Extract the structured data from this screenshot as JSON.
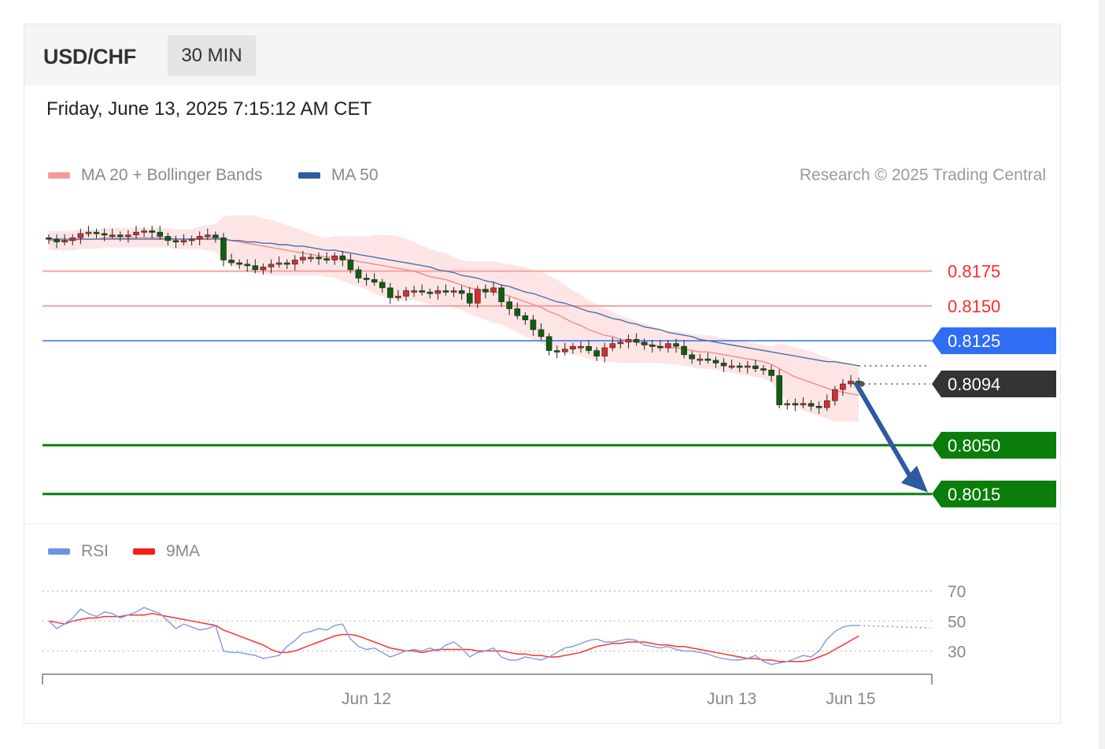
{
  "header": {
    "symbol": "USD/CHF",
    "timeframe": "30 MIN"
  },
  "timestamp": "Friday, June 13, 2025 7:15:12 AM CET",
  "legend": {
    "main": [
      {
        "label": "MA 20 + Bollinger Bands",
        "color": "#f59a9a"
      },
      {
        "label": "MA 50",
        "color": "#2f5d9e"
      }
    ],
    "rsi": [
      {
        "label": "RSI",
        "color": "#6f93e0"
      },
      {
        "label": "9MA",
        "color": "#ff1a1a"
      }
    ]
  },
  "credit": "Research © 2025 Trading Central",
  "colors": {
    "resistance": "#ff2b2b",
    "pivot": "#2f6df5",
    "support": "#0a7d0a",
    "current": "#333333",
    "arrow": "#2d5aa0",
    "bull": "#d43030",
    "bear": "#0f5f0f"
  },
  "chart_data": {
    "type": "candlestick",
    "instrument": "USD/CHF",
    "interval": "30 MIN",
    "levels": [
      {
        "value": 0.8175,
        "label": "0.8175",
        "role": "resistance"
      },
      {
        "value": 0.815,
        "label": "0.8150",
        "role": "resistance"
      },
      {
        "value": 0.8125,
        "label": "0.8125",
        "role": "pivot"
      },
      {
        "value": 0.8094,
        "label": "0.8094",
        "role": "current"
      },
      {
        "value": 0.805,
        "label": "0.8050",
        "role": "support"
      },
      {
        "value": 0.8015,
        "label": "0.8015",
        "role": "support"
      }
    ],
    "price_range": [
      0.8007,
      0.822
    ],
    "forecast_arrow": {
      "from": 0.8094,
      "to": 0.8015
    },
    "close": [
      0.8198,
      0.8196,
      0.8197,
      0.8199,
      0.8202,
      0.8203,
      0.8202,
      0.8201,
      0.8201,
      0.82,
      0.8201,
      0.8203,
      0.8204,
      0.8203,
      0.82,
      0.8197,
      0.8196,
      0.8197,
      0.8198,
      0.82,
      0.8201,
      0.8199,
      0.8183,
      0.8181,
      0.818,
      0.8179,
      0.8176,
      0.8178,
      0.818,
      0.8181,
      0.818,
      0.8183,
      0.8185,
      0.8185,
      0.8184,
      0.8183,
      0.8186,
      0.8183,
      0.8176,
      0.817,
      0.8169,
      0.8167,
      0.8163,
      0.8156,
      0.8157,
      0.8161,
      0.8161,
      0.816,
      0.8159,
      0.8161,
      0.816,
      0.8161,
      0.8159,
      0.8152,
      0.8162,
      0.816,
      0.8163,
      0.8153,
      0.8148,
      0.8143,
      0.814,
      0.8133,
      0.8128,
      0.8118,
      0.8117,
      0.8119,
      0.8121,
      0.8121,
      0.8118,
      0.8114,
      0.812,
      0.8123,
      0.8124,
      0.8126,
      0.8124,
      0.8122,
      0.8121,
      0.812,
      0.8123,
      0.8121,
      0.8115,
      0.8112,
      0.8112,
      0.8111,
      0.8109,
      0.8107,
      0.8107,
      0.8106,
      0.8107,
      0.8105,
      0.8104,
      0.81,
      0.8079,
      0.808,
      0.8079,
      0.808,
      0.8078,
      0.8077,
      0.8082,
      0.809,
      0.8094,
      0.8096,
      0.8094
    ],
    "ma20": [
      0.8197,
      0.8197,
      0.8197,
      0.8197,
      0.8198,
      0.8198,
      0.8198,
      0.8199,
      0.8199,
      0.8199,
      0.8199,
      0.8199,
      0.8199,
      0.8199,
      0.8199,
      0.8199,
      0.8198,
      0.8198,
      0.8198,
      0.8199,
      0.8199,
      0.8199,
      0.8198,
      0.8197,
      0.8196,
      0.8195,
      0.8194,
      0.8193,
      0.8192,
      0.8191,
      0.819,
      0.8189,
      0.8188,
      0.8187,
      0.8186,
      0.8185,
      0.8185,
      0.8184,
      0.8183,
      0.8182,
      0.8181,
      0.818,
      0.8179,
      0.8178,
      0.8177,
      0.8176,
      0.8175,
      0.8173,
      0.8171,
      0.817,
      0.8169,
      0.8167,
      0.8165,
      0.8163,
      0.8162,
      0.8161,
      0.816,
      0.8159,
      0.8157,
      0.8155,
      0.8153,
      0.8151,
      0.8149,
      0.8146,
      0.8144,
      0.8141,
      0.8138,
      0.8136,
      0.8133,
      0.8131,
      0.8129,
      0.8128,
      0.8126,
      0.8125,
      0.8124,
      0.8123,
      0.8122,
      0.8121,
      0.812,
      0.812,
      0.8119,
      0.8118,
      0.8117,
      0.8117,
      0.8116,
      0.8115,
      0.8114,
      0.8113,
      0.8112,
      0.8111,
      0.811,
      0.8108,
      0.8105,
      0.8102,
      0.8099,
      0.8097,
      0.8095,
      0.8093,
      0.8091,
      0.8089,
      0.8088,
      0.8087,
      0.8086
    ],
    "ma50": [
      0.8198,
      0.8198,
      0.8198,
      0.8198,
      0.8198,
      0.8198,
      0.8198,
      0.8198,
      0.8198,
      0.8198,
      0.8198,
      0.8198,
      0.8198,
      0.8198,
      0.8198,
      0.8198,
      0.8198,
      0.8198,
      0.8198,
      0.8198,
      0.8198,
      0.8198,
      0.8198,
      0.8197,
      0.8197,
      0.8196,
      0.8196,
      0.8195,
      0.8195,
      0.8194,
      0.8194,
      0.8193,
      0.8193,
      0.8192,
      0.8191,
      0.819,
      0.819,
      0.8189,
      0.8188,
      0.8187,
      0.8186,
      0.8185,
      0.8184,
      0.8183,
      0.8182,
      0.8181,
      0.818,
      0.8179,
      0.8178,
      0.8176,
      0.8175,
      0.8174,
      0.8172,
      0.8171,
      0.817,
      0.8168,
      0.8167,
      0.8165,
      0.8164,
      0.8162,
      0.816,
      0.8159,
      0.8157,
      0.8155,
      0.8153,
      0.8152,
      0.815,
      0.8148,
      0.8146,
      0.8145,
      0.8143,
      0.8141,
      0.814,
      0.8138,
      0.8137,
      0.8135,
      0.8134,
      0.8133,
      0.8131,
      0.813,
      0.8129,
      0.8128,
      0.8126,
      0.8125,
      0.8124,
      0.8123,
      0.8122,
      0.8121,
      0.812,
      0.8119,
      0.8118,
      0.8117,
      0.8116,
      0.8115,
      0.8114,
      0.8113,
      0.8112,
      0.8111,
      0.811,
      0.811,
      0.8109,
      0.8108,
      0.8107
    ],
    "bb_width": [
      0.0007,
      0.0007,
      0.0007,
      0.0007,
      0.0007,
      0.0007,
      0.0007,
      0.0007,
      0.0007,
      0.0007,
      0.0007,
      0.0007,
      0.0007,
      0.0007,
      0.0007,
      0.0007,
      0.0007,
      0.0007,
      0.0007,
      0.0008,
      0.0009,
      0.001,
      0.0016,
      0.0018,
      0.0019,
      0.002,
      0.0021,
      0.002,
      0.002,
      0.0019,
      0.0018,
      0.0017,
      0.0016,
      0.0015,
      0.0014,
      0.0014,
      0.0015,
      0.0016,
      0.0017,
      0.0018,
      0.0019,
      0.0021,
      0.0022,
      0.0023,
      0.0023,
      0.0022,
      0.0021,
      0.002,
      0.002,
      0.0019,
      0.0019,
      0.0018,
      0.0018,
      0.0019,
      0.002,
      0.0021,
      0.0022,
      0.0022,
      0.0023,
      0.0024,
      0.0025,
      0.0025,
      0.0026,
      0.0026,
      0.0025,
      0.0024,
      0.0023,
      0.0022,
      0.0021,
      0.002,
      0.0019,
      0.0018,
      0.0017,
      0.0016,
      0.0015,
      0.0014,
      0.0013,
      0.0012,
      0.0012,
      0.0012,
      0.0012,
      0.0012,
      0.0012,
      0.0012,
      0.0012,
      0.0012,
      0.0012,
      0.0012,
      0.0012,
      0.0012,
      0.0012,
      0.0013,
      0.0018,
      0.002,
      0.0021,
      0.0022,
      0.0022,
      0.0022,
      0.0022,
      0.0022,
      0.0021,
      0.002,
      0.0019
    ],
    "rsi": [
      50,
      45,
      48,
      52,
      58,
      55,
      53,
      56,
      55,
      52,
      54,
      56,
      59,
      57,
      55,
      50,
      45,
      48,
      46,
      44,
      45,
      47,
      30,
      29,
      29,
      28,
      27,
      25,
      26,
      27,
      33,
      37,
      42,
      43,
      45,
      44,
      47,
      48,
      38,
      33,
      31,
      32,
      29,
      26,
      28,
      30,
      31,
      30,
      32,
      30,
      34,
      36,
      32,
      26,
      29,
      30,
      32,
      26,
      24,
      24,
      26,
      25,
      24,
      26,
      29,
      32,
      33,
      35,
      37,
      38,
      36,
      36,
      37,
      38,
      37,
      34,
      33,
      32,
      33,
      31,
      30,
      30,
      29,
      28,
      26,
      25,
      24,
      24,
      25,
      27,
      23,
      21,
      22,
      23,
      25,
      27,
      26,
      30,
      38,
      43,
      46,
      47,
      47
    ],
    "rsi_ma9": [
      50,
      49,
      48,
      50,
      51,
      52,
      52,
      53,
      53,
      53,
      54,
      54,
      54,
      55,
      54,
      53,
      52,
      51,
      50,
      49,
      48,
      47,
      44,
      42,
      40,
      38,
      36,
      34,
      31,
      29,
      29,
      30,
      32,
      34,
      36,
      38,
      40,
      41,
      41,
      40,
      38,
      36,
      34,
      32,
      31,
      30,
      30,
      29,
      30,
      31,
      31,
      31,
      31,
      31,
      30,
      30,
      30,
      30,
      29,
      28,
      28,
      27,
      27,
      26,
      26,
      27,
      28,
      29,
      31,
      33,
      34,
      35,
      35,
      36,
      36,
      36,
      35,
      34,
      34,
      33,
      33,
      32,
      31,
      30,
      29,
      28,
      27,
      26,
      25,
      25,
      24,
      24,
      23,
      23,
      23,
      23,
      24,
      26,
      28,
      31,
      34,
      37,
      40
    ],
    "rsi_ticks": [
      70,
      50,
      30
    ],
    "rsi_range": [
      15,
      78
    ],
    "x_ticks": [
      {
        "label": "Jun 12",
        "index": 40
      },
      {
        "label": "Jun 13",
        "index": 86
      },
      {
        "label": "Jun 15",
        "index": 101
      }
    ],
    "total_slots": 112
  }
}
